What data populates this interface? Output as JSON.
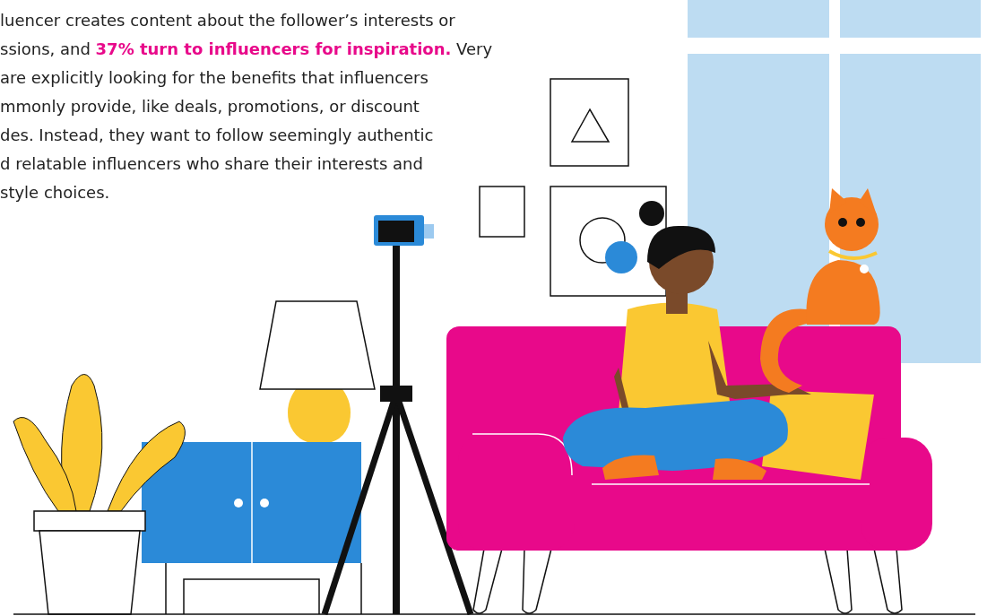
{
  "article": {
    "lines": [
      "luencer creates content about the follower’s interests or",
      "ssions, and **37% turn to influencers for inspiration.** Very",
      "are explicitly looking for the benefits that influencers",
      "mmonly provide, like deals, promotions, or discount",
      "des. Instead, they want to follow seemingly authentic",
      "d relatable influencers who share their interests and",
      "style choices."
    ]
  }
}
